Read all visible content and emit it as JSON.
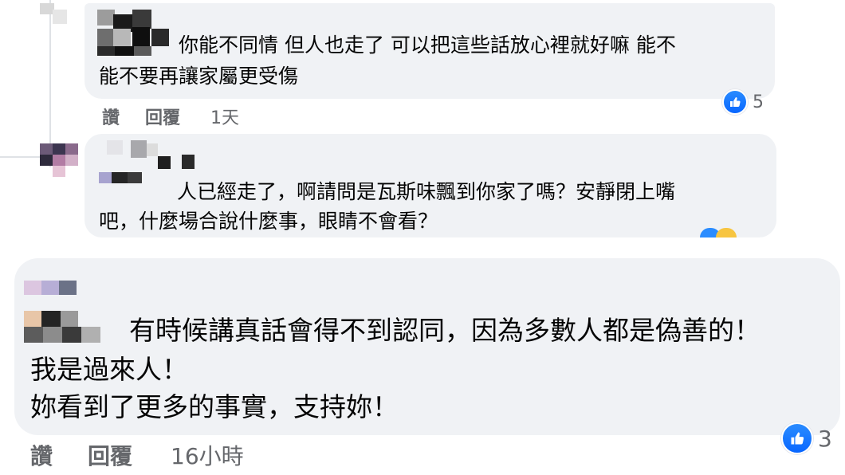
{
  "comments": [
    {
      "text_lines": [
        "你能不同情 但人也走了 可以把這些話放心裡就好嘛 能不",
        "能不要再讓家屬更受傷"
      ],
      "actions": {
        "like": "讚",
        "reply": "回覆"
      },
      "time": "1天",
      "reactions": {
        "icon": "like-icon",
        "count": "5"
      }
    },
    {
      "text_lines": [
        "人已經走了，啊請問是瓦斯味飄到你家了嗎？安靜閉上嘴",
        "吧，什麼場合說什麼事，眼睛不會看？"
      ]
    },
    {
      "text_lines": [
        "有時候講真話會得不到認同，因為多數人都是偽善的！",
        "我是過來人！",
        "妳看到了更多的事實，支持妳！"
      ],
      "actions": {
        "like": "讚",
        "reply": "回覆"
      },
      "time": "16小時",
      "reactions": {
        "icon": "like-icon",
        "count": "3"
      }
    }
  ],
  "colors": {
    "bubble_bg": "#f0f2f5",
    "meta_text": "#65676b",
    "like_blue": "#0866ff"
  }
}
